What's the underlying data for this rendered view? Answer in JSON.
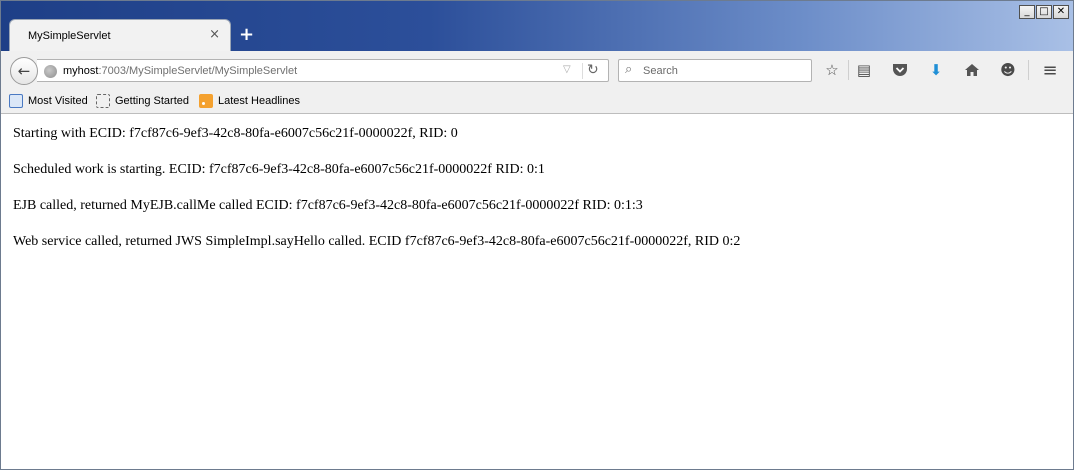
{
  "window": {
    "controls": {
      "minimize": "_",
      "maximize": "□",
      "close": "✕"
    }
  },
  "tab": {
    "title": "MySimpleServlet",
    "close_glyph": "×",
    "new_tab_glyph": "+"
  },
  "navbar": {
    "back_icon": "arrow-left-icon",
    "back_glyph": "←",
    "url_host": "myhost",
    "url_rest": ":7003/MySimpleServlet/MySimpleServlet",
    "url_dropdown_glyph": "▽",
    "reload_glyph": "↻",
    "search_placeholder": "Search",
    "search_glyph": "🔍",
    "tools": {
      "bookmark_star": "☆",
      "reading_list": "▤",
      "pocket": "◡",
      "download": "⬇",
      "home": "⌂",
      "chat": "☻",
      "menu": "≡"
    }
  },
  "bookmarks": [
    {
      "label": "Most Visited",
      "icon": "most-visited-icon"
    },
    {
      "label": "Getting Started",
      "icon": "getting-started-icon"
    },
    {
      "label": "Latest Headlines",
      "icon": "rss-icon"
    }
  ],
  "content": {
    "lines": [
      "Starting with ECID: f7cf87c6-9ef3-42c8-80fa-e6007c56c21f-0000022f, RID: 0",
      "Scheduled work is starting. ECID: f7cf87c6-9ef3-42c8-80fa-e6007c56c21f-0000022f RID: 0:1",
      "EJB called, returned MyEJB.callMe called ECID: f7cf87c6-9ef3-42c8-80fa-e6007c56c21f-0000022f RID: 0:1:3",
      "Web service called, returned JWS SimpleImpl.sayHello called. ECID f7cf87c6-9ef3-42c8-80fa-e6007c56c21f-0000022f, RID 0:2"
    ]
  },
  "colors": {
    "titlebar_start": "#1e3f87",
    "titlebar_end": "#a9c0e6",
    "toolbar_bg": "#f0f0f0",
    "download_accent": "#1f8fd6"
  }
}
